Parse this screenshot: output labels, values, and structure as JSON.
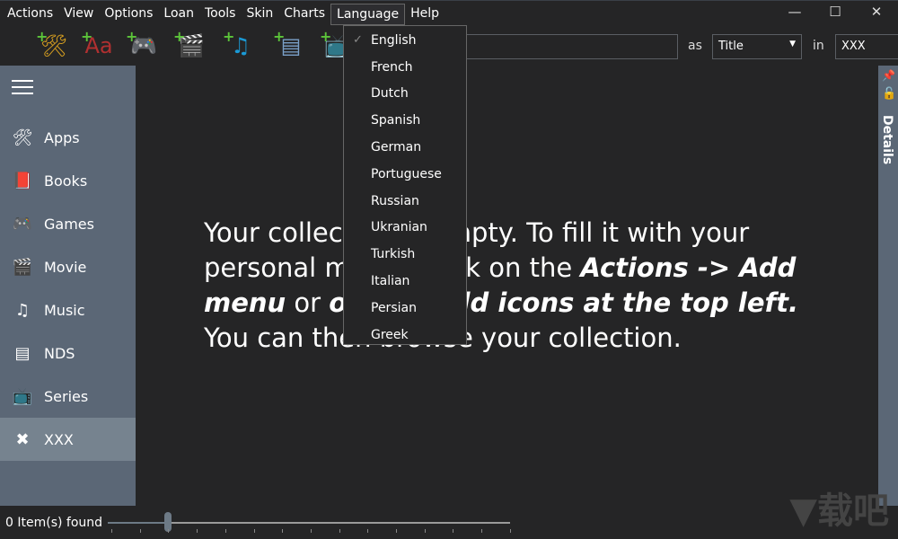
{
  "menubar": {
    "items": [
      "Actions",
      "View",
      "Options",
      "Loan",
      "Tools",
      "Skin",
      "Charts",
      "Language",
      "Help"
    ],
    "open": "Language"
  },
  "window": {
    "minimize": "—",
    "maximize": "☐",
    "close": "✕"
  },
  "toolbar": [
    {
      "name": "add-apps",
      "glyph": "🛠",
      "color": "#d8a020"
    },
    {
      "name": "add-books",
      "glyph": "Aa",
      "color": "#b03030"
    },
    {
      "name": "add-games",
      "glyph": "🎮",
      "color": "#bbbbbb"
    },
    {
      "name": "add-movie",
      "glyph": "🎬",
      "color": "#2a6dd0"
    },
    {
      "name": "add-music",
      "glyph": "♫",
      "color": "#1a9ad6"
    },
    {
      "name": "add-nds",
      "glyph": "▤",
      "color": "#7aa0c8"
    },
    {
      "name": "add-series",
      "glyph": "📺",
      "color": "#d08a2a"
    }
  ],
  "search": {
    "value": "",
    "as_label": "as",
    "field": "Title",
    "in_label": "in",
    "scope": "XXX"
  },
  "sidebar": {
    "items": [
      {
        "label": "Apps",
        "glyph": "🛠"
      },
      {
        "label": "Books",
        "glyph": "📕"
      },
      {
        "label": "Games",
        "glyph": "🎮"
      },
      {
        "label": "Movie",
        "glyph": "🎬"
      },
      {
        "label": "Music",
        "glyph": "♫"
      },
      {
        "label": "NDS",
        "glyph": "▤"
      },
      {
        "label": "Series",
        "glyph": "📺"
      },
      {
        "label": "XXX",
        "glyph": "✖"
      }
    ],
    "selected": "XXX"
  },
  "message": {
    "p1": "Your collection is empty. To fill it with your personal media, click on the ",
    "b1": "Actions -> Add menu",
    "p2": " or ",
    "b2": "on the Add icons at the top left.",
    "p3": " You can then browse your collection."
  },
  "details": {
    "label": "Details"
  },
  "status": {
    "items_found": "0 Item(s) found",
    "zoom_level": 0.15
  },
  "language_menu": {
    "items": [
      "English",
      "French",
      "Dutch",
      "Spanish",
      "German",
      "Portuguese",
      "Russian",
      "Ukranian",
      "Turkish",
      "Italian",
      "Persian",
      "Greek"
    ],
    "checked": "English",
    "check_glyph": "✓"
  },
  "watermark": "下载吧"
}
